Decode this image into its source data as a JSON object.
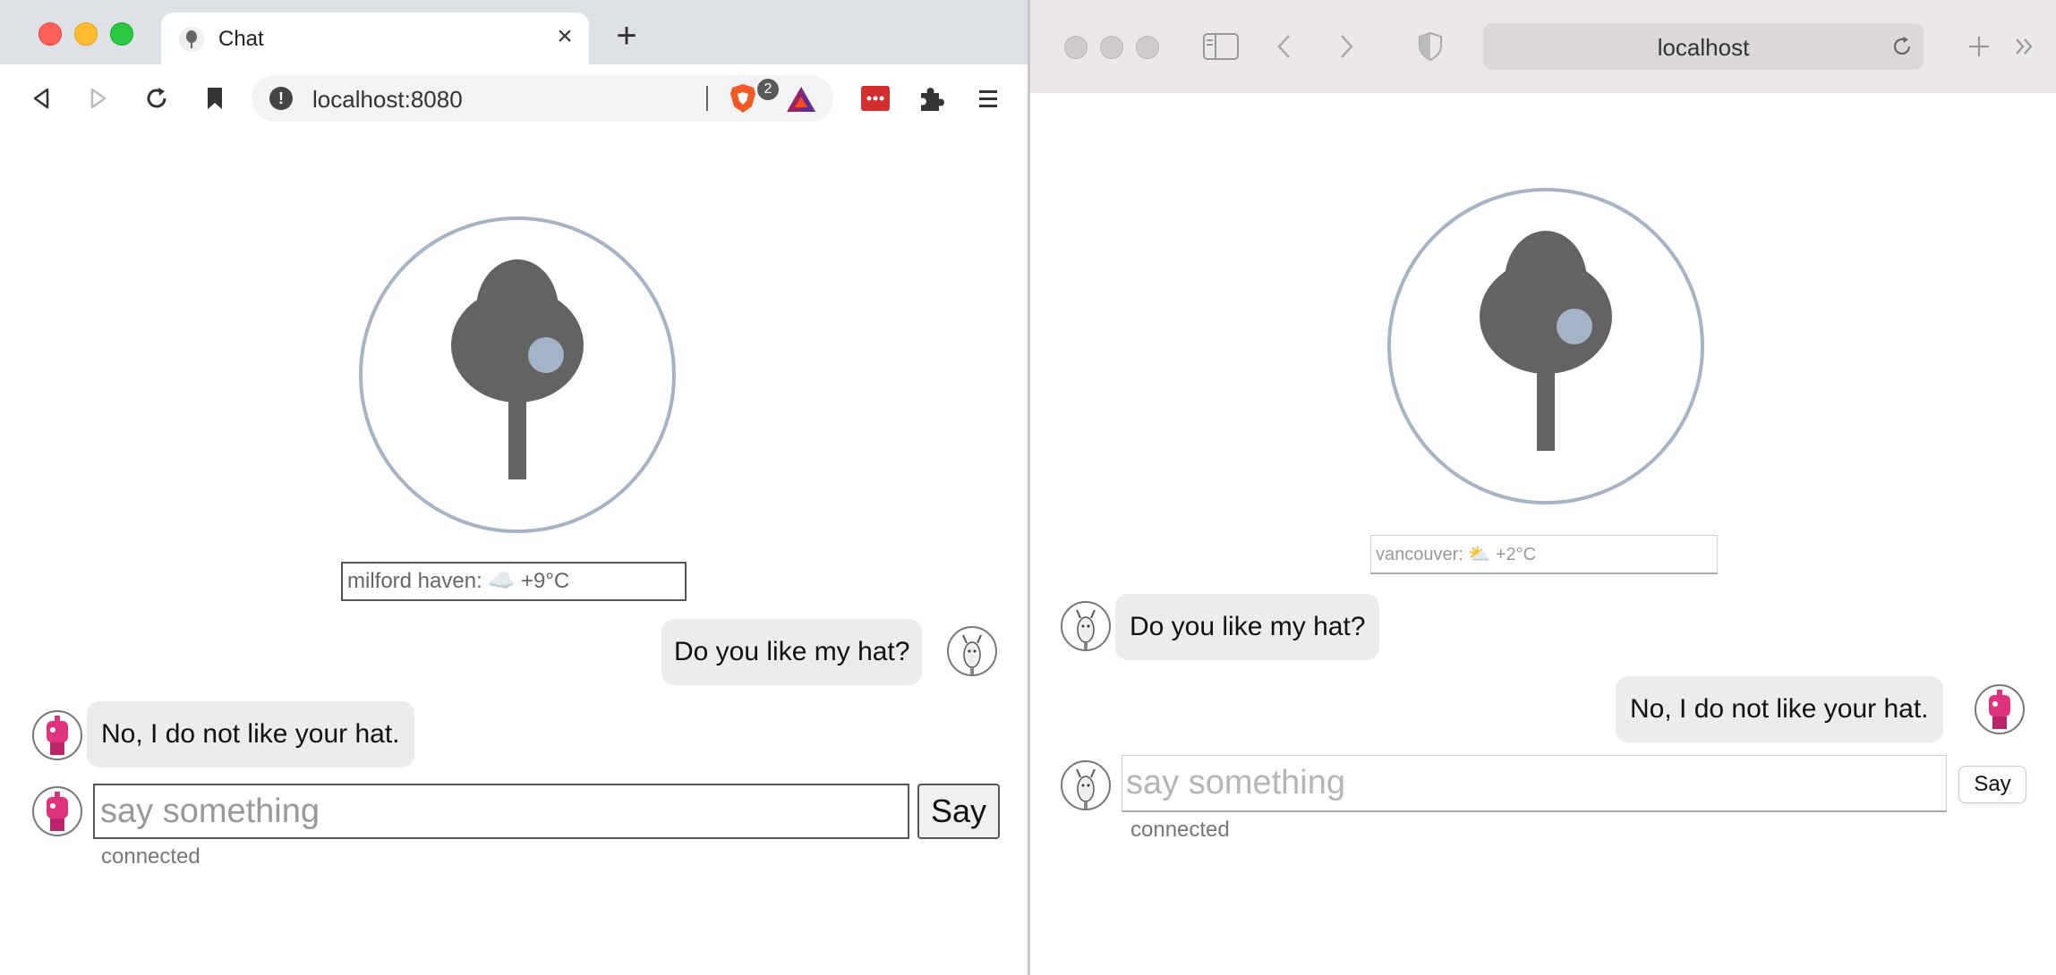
{
  "left_window": {
    "tab_title": "Chat",
    "url": "localhost:8080",
    "shield_badge_count": "2",
    "weather": "milford haven: ☁️  +9°C",
    "messages": [
      {
        "text": "Do you like my hat?",
        "side": "right"
      },
      {
        "text": "No, I do not like your hat.",
        "side": "left"
      }
    ],
    "input_placeholder": "say something",
    "say_button": "Say",
    "status": "connected"
  },
  "right_window": {
    "url": "localhost",
    "weather": "vancouver: ⛅  +2°C",
    "messages": [
      {
        "text": "Do you like my hat?",
        "side": "left"
      },
      {
        "text": "No, I do not like your hat.",
        "side": "right"
      }
    ],
    "input_placeholder": "say something",
    "say_button": "Say",
    "status": "connected"
  },
  "colors": {
    "logo_ring": "#a5b3c6",
    "logo_tree": "#636363",
    "logo_dot": "#a5b3c6",
    "bubble": "#ececec",
    "avatar_pink": "#e0337d"
  }
}
